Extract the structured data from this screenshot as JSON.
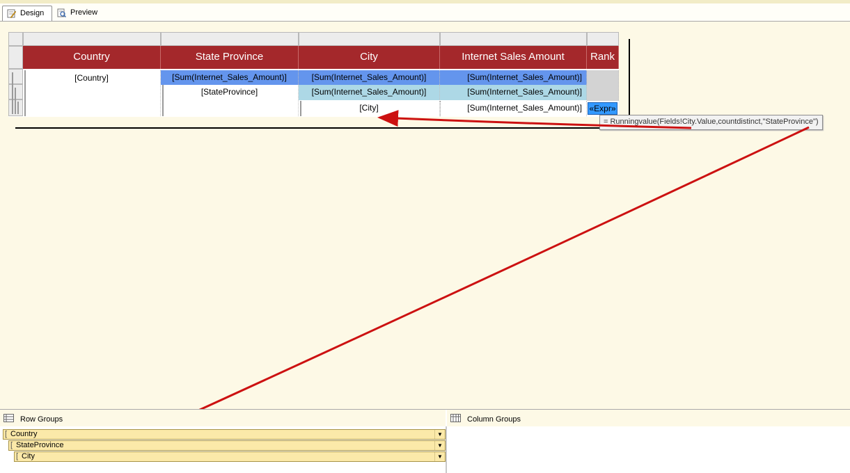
{
  "tabs": [
    {
      "label": "Design",
      "icon": "design-icon",
      "active": true
    },
    {
      "label": "Preview",
      "icon": "preview-icon",
      "active": false
    }
  ],
  "tablix": {
    "headers": [
      "Country",
      "State Province",
      "City",
      "Internet Sales Amount",
      "Rank"
    ],
    "rows": [
      [
        "[Country]",
        "[Sum(Internet_Sales_Amount)]",
        "[Sum(Internet_Sales_Amount)]",
        "[Sum(Internet_Sales_Amount)]",
        ""
      ],
      [
        "",
        "[StateProvince]",
        "[Sum(Internet_Sales_Amount)]",
        "[Sum(Internet_Sales_Amount)]",
        ""
      ],
      [
        "",
        "",
        "[City]",
        "[Sum(Internet_Sales_Amount)]",
        "«Expr»"
      ]
    ],
    "colors": {
      "header": "#a4282b",
      "blue": "#6495ed",
      "light_blue": "#add8e6",
      "gray": "#d3d3d3",
      "expr": "#3399ff"
    }
  },
  "tooltip": "= Runningvalue(Fields!City.Value,countdistinct,\"StateProvince\")",
  "arrow_color": "#cc1111",
  "row_groups": {
    "title": "Row Groups",
    "items": [
      "Country",
      "StateProvince",
      "City"
    ]
  },
  "column_groups": {
    "title": "Column Groups"
  }
}
